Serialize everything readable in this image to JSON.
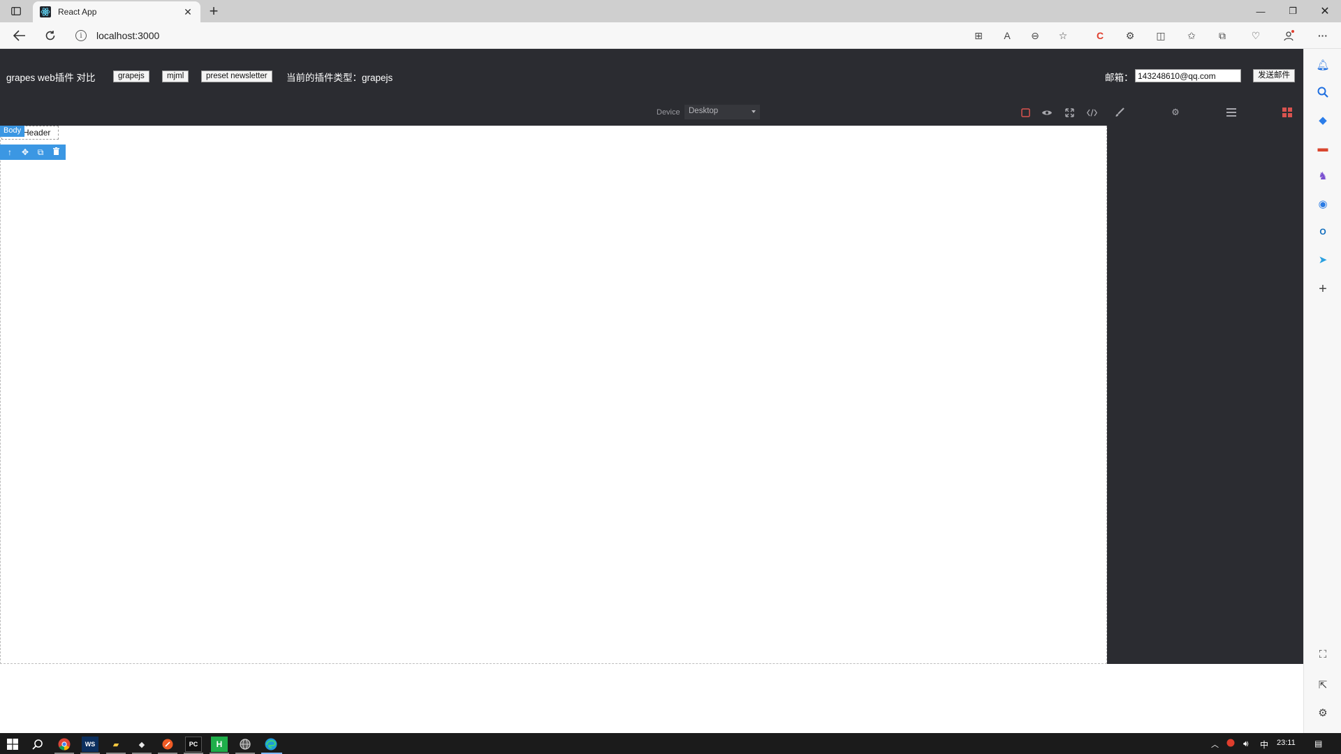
{
  "browser": {
    "tab_title": "React App",
    "url": "localhost:3000"
  },
  "app_header": {
    "title": "grapes web插件 对比",
    "buttons": {
      "grapejs": "grapejs",
      "mjml": "mjml",
      "preset_newsletter": "preset newsletter"
    },
    "plugin_type_label": "当前的插件类型：grapejs",
    "email_label": "邮箱：",
    "email_value": "143248610@qq.com",
    "send_label": "发送邮件"
  },
  "editor": {
    "device_label": "Device",
    "device_value": "Desktop",
    "body_badge": "Body",
    "component_text": "Header"
  },
  "taskbar": {
    "pc_label": "PC",
    "h_label": "H",
    "ime_label": "中",
    "time": "23:11"
  },
  "colors": {
    "panel_bg": "#2b2c31",
    "accent_blue": "#3b97e3",
    "active_red": "#d9534f"
  }
}
